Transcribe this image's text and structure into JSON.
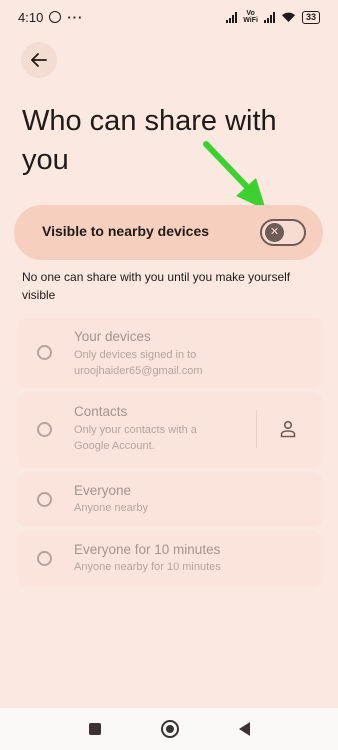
{
  "status_bar": {
    "time": "4:10",
    "more": "···",
    "vo_label": "Vo",
    "wifi_label": "WiFi",
    "battery": "33"
  },
  "header": {
    "back_icon": "arrow-left-icon"
  },
  "page": {
    "title": "Who can share with you"
  },
  "visibility": {
    "label": "Visible to nearby devices",
    "toggle_on": false,
    "toggle_icon": "close-icon"
  },
  "helper_text": "No one can share with you until you make yourself visible",
  "options": [
    {
      "title": "Your devices",
      "subtitle": "Only devices signed in to uroojhaider65@gmail.com"
    },
    {
      "title": "Contacts",
      "subtitle": "Only your contacts with a Google Account.",
      "icon": "person-icon"
    },
    {
      "title": "Everyone",
      "subtitle": "Anyone nearby"
    },
    {
      "title": "Everyone for 10 minutes",
      "subtitle": "Anyone nearby for 10 minutes"
    }
  ],
  "nav_bar": {
    "recent_icon": "square-icon",
    "home_icon": "circle-home-icon",
    "back_icon": "triangle-back-icon"
  },
  "colors": {
    "background": "#fbe8e0",
    "card": "#f7cfbf",
    "annotation_arrow": "#3dd130"
  }
}
